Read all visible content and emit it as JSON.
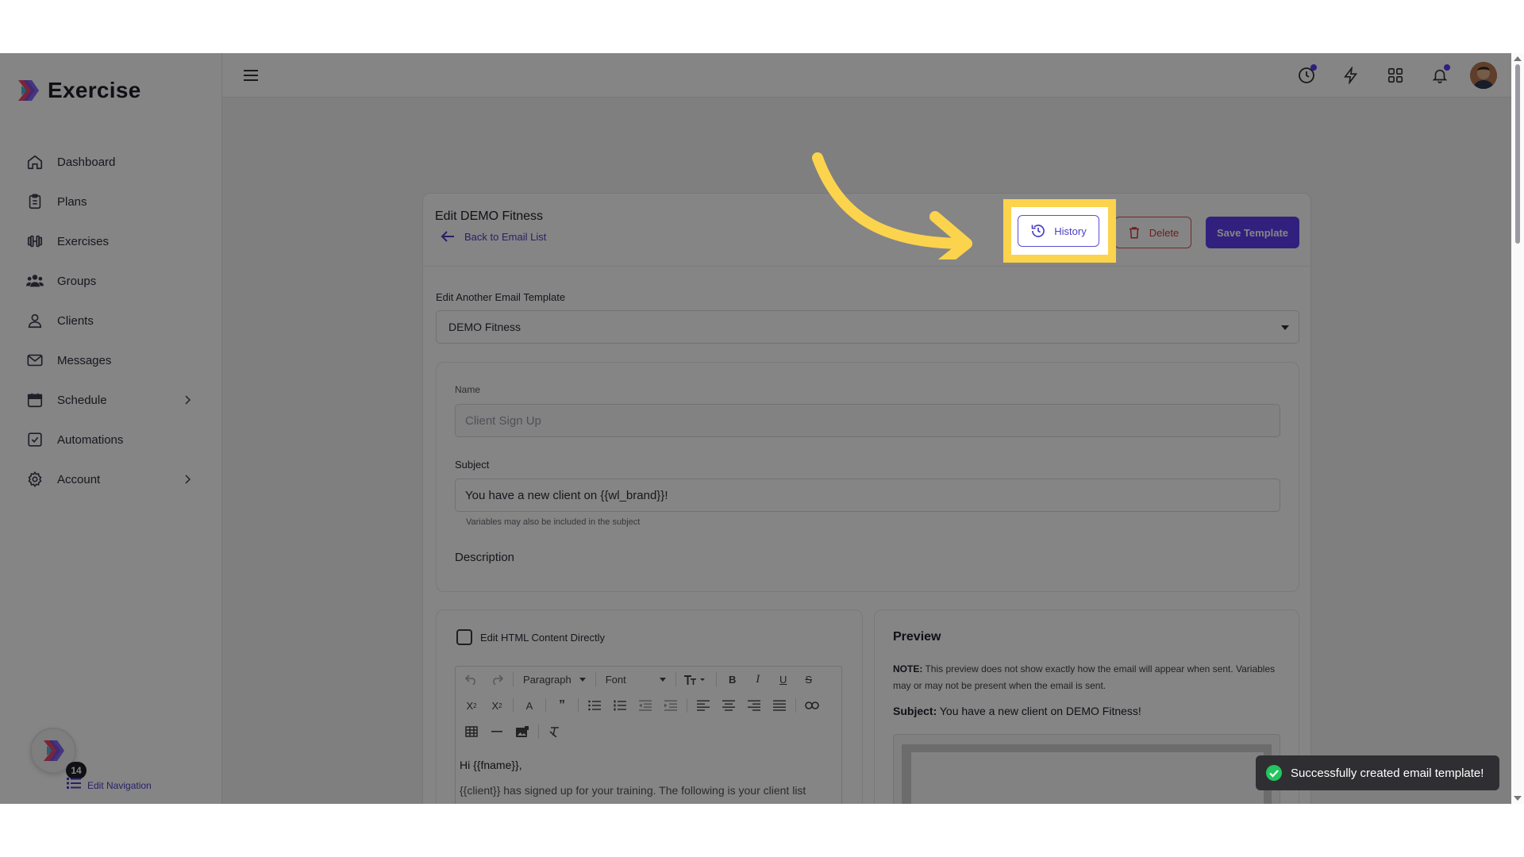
{
  "app": {
    "name": "Exercise"
  },
  "sidebar": {
    "items": [
      {
        "label": "Dashboard",
        "icon": "home-icon"
      },
      {
        "label": "Plans",
        "icon": "clipboard-icon"
      },
      {
        "label": "Exercises",
        "icon": "dumbbell-icon"
      },
      {
        "label": "Groups",
        "icon": "users-icon"
      },
      {
        "label": "Clients",
        "icon": "user-icon"
      },
      {
        "label": "Messages",
        "icon": "mail-icon"
      },
      {
        "label": "Schedule",
        "icon": "calendar-icon",
        "expandable": true
      },
      {
        "label": "Automations",
        "icon": "checkbox-icon"
      },
      {
        "label": "Account",
        "icon": "gear-icon",
        "expandable": true
      }
    ],
    "badge_count": "14",
    "edit_navigation_label": "Edit Navigation"
  },
  "page": {
    "title": "Edit DEMO Fitness",
    "back_link": "Back to Email List",
    "buttons": {
      "history": "History",
      "delete": "Delete",
      "save": "Save Template"
    },
    "template_select": {
      "label": "Edit Another Email Template",
      "value": "DEMO Fitness"
    },
    "form": {
      "name_label": "Name",
      "name_placeholder": "Client Sign Up",
      "subject_label": "Subject",
      "subject_value": "You have a new client on {{wl_brand}}!",
      "subject_hint": "Variables may also be included in the subject",
      "description_label": "Description"
    },
    "editor": {
      "html_toggle_label": "Edit HTML Content Directly",
      "paragraph_select": "Paragraph",
      "font_select": "Font",
      "content_line1": "Hi {{fname}},",
      "content_line2": "{{client}} has signed up for your training. The following is your client list"
    },
    "preview": {
      "title": "Preview",
      "note_prefix": "NOTE:",
      "note_text": " This preview does not show exactly how the email will appear when sent. Variables may or may not be present when the email is sent.",
      "subject_prefix": "Subject:",
      "subject_text": " You have a new client on DEMO Fitness!"
    }
  },
  "toast": {
    "message": "Successfully created email template!"
  },
  "colors": {
    "accent": "#5f3ff0",
    "danger": "#d63939",
    "highlight": "#fcd34d",
    "toast_success": "#22c55e"
  }
}
